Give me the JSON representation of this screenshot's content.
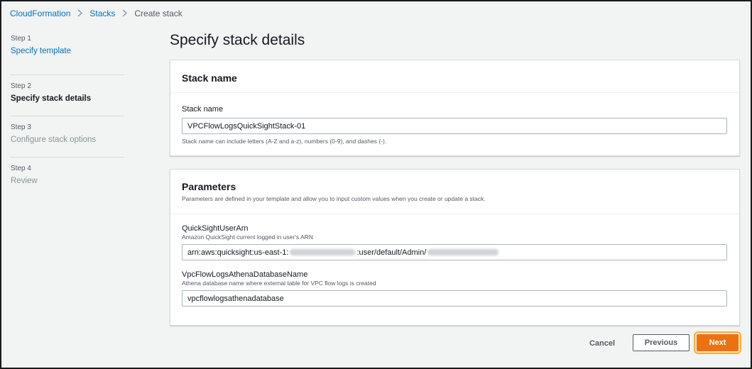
{
  "breadcrumb": {
    "items": [
      {
        "label": "CloudFormation",
        "link": true
      },
      {
        "label": "Stacks",
        "link": true
      },
      {
        "label": "Create stack",
        "link": false
      }
    ],
    "separator_icon": "chevron-right-icon"
  },
  "steps": [
    {
      "number": "Step 1",
      "title": "Specify template",
      "state": "link"
    },
    {
      "number": "Step 2",
      "title": "Specify stack details",
      "state": "active"
    },
    {
      "number": "Step 3",
      "title": "Configure stack options",
      "state": "disabled"
    },
    {
      "number": "Step 4",
      "title": "Review",
      "state": "disabled"
    }
  ],
  "page_title": "Specify stack details",
  "stack_name_panel": {
    "title": "Stack name",
    "field_label": "Stack name",
    "value": "VPCFlowLogsQuickSightStack-01",
    "constraint": "Stack name can include letters (A-Z and a-z), numbers (0-9), and dashes (-)."
  },
  "parameters_panel": {
    "title": "Parameters",
    "description": "Parameters are defined in your template and allow you to input custom values when you create or update a stack.",
    "params": [
      {
        "label": "QuickSightUserArn",
        "description": "Amazon QuickSight current logged in user's ARN",
        "value_prefix": "arn:aws:quicksight:us-east-1:",
        "value_middle": ":user/default/Admin/"
      },
      {
        "label": "VpcFlowLogsAthenaDatabaseName",
        "description": "Athena database name where external table for VPC flow logs is created",
        "value": "vpcflowlogsathenadatabase"
      }
    ]
  },
  "buttons": {
    "cancel": "Cancel",
    "previous": "Previous",
    "next": "Next"
  },
  "colors": {
    "link": "#0073bb",
    "primary": "#ec7211",
    "focus_ring": "#f6b142",
    "background": "#f2f3f3"
  }
}
